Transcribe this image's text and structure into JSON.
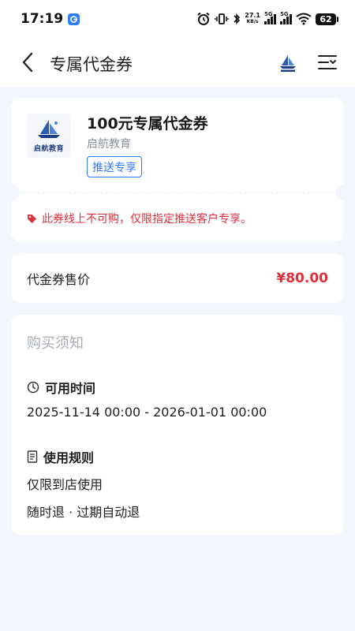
{
  "status_bar": {
    "time": "17:19",
    "net_speed_value": "27.1",
    "net_speed_unit": "KB/s",
    "signal1_label": "5G",
    "signal2_label": "5G",
    "battery": "62"
  },
  "header": {
    "title": "专属代金券"
  },
  "voucher": {
    "title": "100元专属代金券",
    "merchant": "启航教育",
    "logo_text": "启航教育",
    "tag": "推送专享",
    "warning": "此券线上不可购，仅限指定推送客户专享。"
  },
  "price": {
    "label": "代金券售价",
    "value": "¥80.00"
  },
  "notice": {
    "title": "购买须知",
    "time_section": {
      "heading": "可用时间",
      "value": "2025-11-14 00:00 - 2026-01-01 00:00"
    },
    "rules_section": {
      "heading": "使用规则",
      "rules": [
        "仅限到店使用",
        "随时退 · 过期自动退"
      ]
    }
  },
  "colors": {
    "accent_blue": "#2f7cf6",
    "price_red": "#e02e3a",
    "page_bg": "#f3f6fc"
  },
  "icons": {
    "back": "chevron-left-icon",
    "menu": "menu-lines-icon",
    "time": "clock-icon",
    "rules": "document-icon",
    "warning": "tag-icon"
  }
}
